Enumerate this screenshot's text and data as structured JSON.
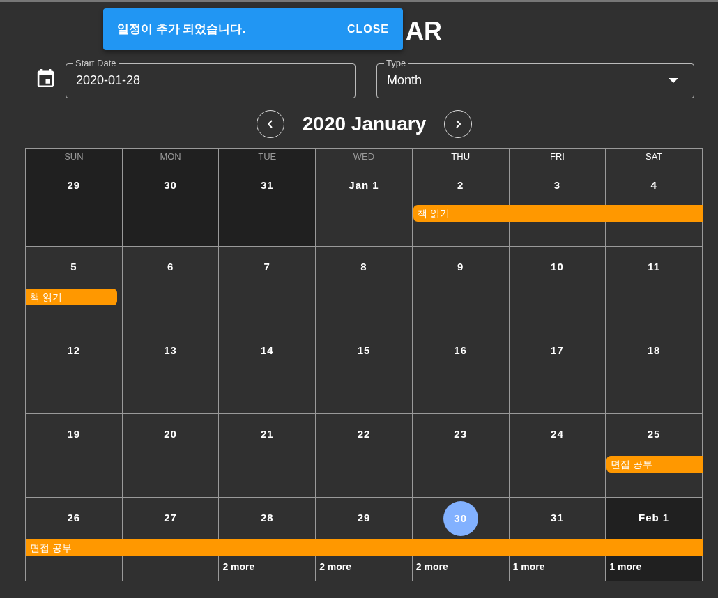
{
  "snackbar": {
    "message": "일정이 추가 되었습니다.",
    "action": "CLOSE"
  },
  "title": "AR",
  "start_date": {
    "label": "Start Date",
    "value": "2020-01-28"
  },
  "type_select": {
    "label": "Type",
    "value": "Month"
  },
  "month_title": "2020 January",
  "weekdays": [
    {
      "label": "SUN",
      "dimmed": true
    },
    {
      "label": "MON",
      "dimmed": true
    },
    {
      "label": "TUE",
      "dimmed": true
    },
    {
      "label": "WED",
      "dimmed": true
    },
    {
      "label": "THU",
      "dimmed": false
    },
    {
      "label": "FRI",
      "dimmed": false
    },
    {
      "label": "SAT",
      "dimmed": false
    }
  ],
  "weeks": [
    {
      "days": [
        {
          "date": "29",
          "outside": true,
          "today": false
        },
        {
          "date": "30",
          "outside": true,
          "today": false
        },
        {
          "date": "31",
          "outside": true,
          "today": false
        },
        {
          "date": "Jan 1",
          "outside": false,
          "today": false
        },
        {
          "date": "2",
          "outside": false,
          "today": false,
          "event": {
            "title": "책 읽기",
            "continues_before": false,
            "continues_after": true
          }
        },
        {
          "date": "3",
          "outside": false,
          "today": false
        },
        {
          "date": "4",
          "outside": false,
          "today": false
        }
      ]
    },
    {
      "days": [
        {
          "date": "5",
          "outside": false,
          "today": false,
          "event": {
            "title": "책 읽기",
            "continues_before": true,
            "continues_after": false
          }
        },
        {
          "date": "6",
          "outside": false,
          "today": false
        },
        {
          "date": "7",
          "outside": false,
          "today": false
        },
        {
          "date": "8",
          "outside": false,
          "today": false
        },
        {
          "date": "9",
          "outside": false,
          "today": false
        },
        {
          "date": "10",
          "outside": false,
          "today": false
        },
        {
          "date": "11",
          "outside": false,
          "today": false
        }
      ]
    },
    {
      "days": [
        {
          "date": "12",
          "outside": false,
          "today": false
        },
        {
          "date": "13",
          "outside": false,
          "today": false
        },
        {
          "date": "14",
          "outside": false,
          "today": false
        },
        {
          "date": "15",
          "outside": false,
          "today": false
        },
        {
          "date": "16",
          "outside": false,
          "today": false
        },
        {
          "date": "17",
          "outside": false,
          "today": false
        },
        {
          "date": "18",
          "outside": false,
          "today": false
        }
      ]
    },
    {
      "days": [
        {
          "date": "19",
          "outside": false,
          "today": false
        },
        {
          "date": "20",
          "outside": false,
          "today": false
        },
        {
          "date": "21",
          "outside": false,
          "today": false
        },
        {
          "date": "22",
          "outside": false,
          "today": false
        },
        {
          "date": "23",
          "outside": false,
          "today": false
        },
        {
          "date": "24",
          "outside": false,
          "today": false
        },
        {
          "date": "25",
          "outside": false,
          "today": false,
          "event": {
            "title": "면접 공부",
            "continues_before": false,
            "continues_after": true
          }
        }
      ]
    },
    {
      "days": [
        {
          "date": "26",
          "outside": false,
          "today": false,
          "event": {
            "title": "면접 공부",
            "continues_before": true,
            "continues_after": true
          }
        },
        {
          "date": "27",
          "outside": false,
          "today": false
        },
        {
          "date": "28",
          "outside": false,
          "today": false,
          "more": "2 more"
        },
        {
          "date": "29",
          "outside": false,
          "today": false,
          "more": "2 more"
        },
        {
          "date": "30",
          "outside": false,
          "today": true,
          "more": "2 more"
        },
        {
          "date": "31",
          "outside": false,
          "today": false,
          "more": "1 more"
        },
        {
          "date": "Feb 1",
          "outside": true,
          "today": false,
          "more": "1 more"
        }
      ]
    }
  ]
}
